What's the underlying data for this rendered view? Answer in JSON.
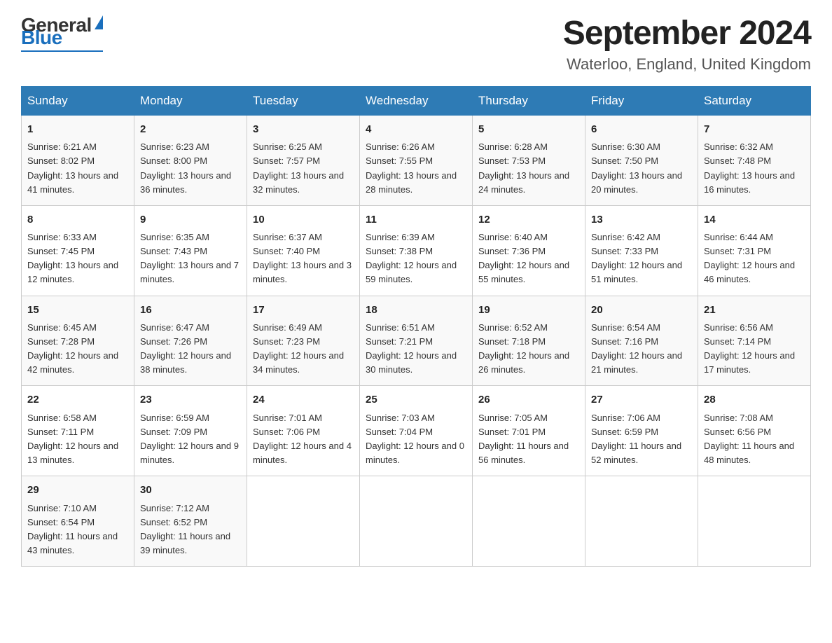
{
  "header": {
    "logo_general": "General",
    "logo_blue": "Blue",
    "month_title": "September 2024",
    "location": "Waterloo, England, United Kingdom"
  },
  "weekdays": [
    "Sunday",
    "Monday",
    "Tuesday",
    "Wednesday",
    "Thursday",
    "Friday",
    "Saturday"
  ],
  "weeks": [
    [
      {
        "day": "1",
        "sunrise": "Sunrise: 6:21 AM",
        "sunset": "Sunset: 8:02 PM",
        "daylight": "Daylight: 13 hours and 41 minutes."
      },
      {
        "day": "2",
        "sunrise": "Sunrise: 6:23 AM",
        "sunset": "Sunset: 8:00 PM",
        "daylight": "Daylight: 13 hours and 36 minutes."
      },
      {
        "day": "3",
        "sunrise": "Sunrise: 6:25 AM",
        "sunset": "Sunset: 7:57 PM",
        "daylight": "Daylight: 13 hours and 32 minutes."
      },
      {
        "day": "4",
        "sunrise": "Sunrise: 6:26 AM",
        "sunset": "Sunset: 7:55 PM",
        "daylight": "Daylight: 13 hours and 28 minutes."
      },
      {
        "day": "5",
        "sunrise": "Sunrise: 6:28 AM",
        "sunset": "Sunset: 7:53 PM",
        "daylight": "Daylight: 13 hours and 24 minutes."
      },
      {
        "day": "6",
        "sunrise": "Sunrise: 6:30 AM",
        "sunset": "Sunset: 7:50 PM",
        "daylight": "Daylight: 13 hours and 20 minutes."
      },
      {
        "day": "7",
        "sunrise": "Sunrise: 6:32 AM",
        "sunset": "Sunset: 7:48 PM",
        "daylight": "Daylight: 13 hours and 16 minutes."
      }
    ],
    [
      {
        "day": "8",
        "sunrise": "Sunrise: 6:33 AM",
        "sunset": "Sunset: 7:45 PM",
        "daylight": "Daylight: 13 hours and 12 minutes."
      },
      {
        "day": "9",
        "sunrise": "Sunrise: 6:35 AM",
        "sunset": "Sunset: 7:43 PM",
        "daylight": "Daylight: 13 hours and 7 minutes."
      },
      {
        "day": "10",
        "sunrise": "Sunrise: 6:37 AM",
        "sunset": "Sunset: 7:40 PM",
        "daylight": "Daylight: 13 hours and 3 minutes."
      },
      {
        "day": "11",
        "sunrise": "Sunrise: 6:39 AM",
        "sunset": "Sunset: 7:38 PM",
        "daylight": "Daylight: 12 hours and 59 minutes."
      },
      {
        "day": "12",
        "sunrise": "Sunrise: 6:40 AM",
        "sunset": "Sunset: 7:36 PM",
        "daylight": "Daylight: 12 hours and 55 minutes."
      },
      {
        "day": "13",
        "sunrise": "Sunrise: 6:42 AM",
        "sunset": "Sunset: 7:33 PM",
        "daylight": "Daylight: 12 hours and 51 minutes."
      },
      {
        "day": "14",
        "sunrise": "Sunrise: 6:44 AM",
        "sunset": "Sunset: 7:31 PM",
        "daylight": "Daylight: 12 hours and 46 minutes."
      }
    ],
    [
      {
        "day": "15",
        "sunrise": "Sunrise: 6:45 AM",
        "sunset": "Sunset: 7:28 PM",
        "daylight": "Daylight: 12 hours and 42 minutes."
      },
      {
        "day": "16",
        "sunrise": "Sunrise: 6:47 AM",
        "sunset": "Sunset: 7:26 PM",
        "daylight": "Daylight: 12 hours and 38 minutes."
      },
      {
        "day": "17",
        "sunrise": "Sunrise: 6:49 AM",
        "sunset": "Sunset: 7:23 PM",
        "daylight": "Daylight: 12 hours and 34 minutes."
      },
      {
        "day": "18",
        "sunrise": "Sunrise: 6:51 AM",
        "sunset": "Sunset: 7:21 PM",
        "daylight": "Daylight: 12 hours and 30 minutes."
      },
      {
        "day": "19",
        "sunrise": "Sunrise: 6:52 AM",
        "sunset": "Sunset: 7:18 PM",
        "daylight": "Daylight: 12 hours and 26 minutes."
      },
      {
        "day": "20",
        "sunrise": "Sunrise: 6:54 AM",
        "sunset": "Sunset: 7:16 PM",
        "daylight": "Daylight: 12 hours and 21 minutes."
      },
      {
        "day": "21",
        "sunrise": "Sunrise: 6:56 AM",
        "sunset": "Sunset: 7:14 PM",
        "daylight": "Daylight: 12 hours and 17 minutes."
      }
    ],
    [
      {
        "day": "22",
        "sunrise": "Sunrise: 6:58 AM",
        "sunset": "Sunset: 7:11 PM",
        "daylight": "Daylight: 12 hours and 13 minutes."
      },
      {
        "day": "23",
        "sunrise": "Sunrise: 6:59 AM",
        "sunset": "Sunset: 7:09 PM",
        "daylight": "Daylight: 12 hours and 9 minutes."
      },
      {
        "day": "24",
        "sunrise": "Sunrise: 7:01 AM",
        "sunset": "Sunset: 7:06 PM",
        "daylight": "Daylight: 12 hours and 4 minutes."
      },
      {
        "day": "25",
        "sunrise": "Sunrise: 7:03 AM",
        "sunset": "Sunset: 7:04 PM",
        "daylight": "Daylight: 12 hours and 0 minutes."
      },
      {
        "day": "26",
        "sunrise": "Sunrise: 7:05 AM",
        "sunset": "Sunset: 7:01 PM",
        "daylight": "Daylight: 11 hours and 56 minutes."
      },
      {
        "day": "27",
        "sunrise": "Sunrise: 7:06 AM",
        "sunset": "Sunset: 6:59 PM",
        "daylight": "Daylight: 11 hours and 52 minutes."
      },
      {
        "day": "28",
        "sunrise": "Sunrise: 7:08 AM",
        "sunset": "Sunset: 6:56 PM",
        "daylight": "Daylight: 11 hours and 48 minutes."
      }
    ],
    [
      {
        "day": "29",
        "sunrise": "Sunrise: 7:10 AM",
        "sunset": "Sunset: 6:54 PM",
        "daylight": "Daylight: 11 hours and 43 minutes."
      },
      {
        "day": "30",
        "sunrise": "Sunrise: 7:12 AM",
        "sunset": "Sunset: 6:52 PM",
        "daylight": "Daylight: 11 hours and 39 minutes."
      },
      null,
      null,
      null,
      null,
      null
    ]
  ]
}
